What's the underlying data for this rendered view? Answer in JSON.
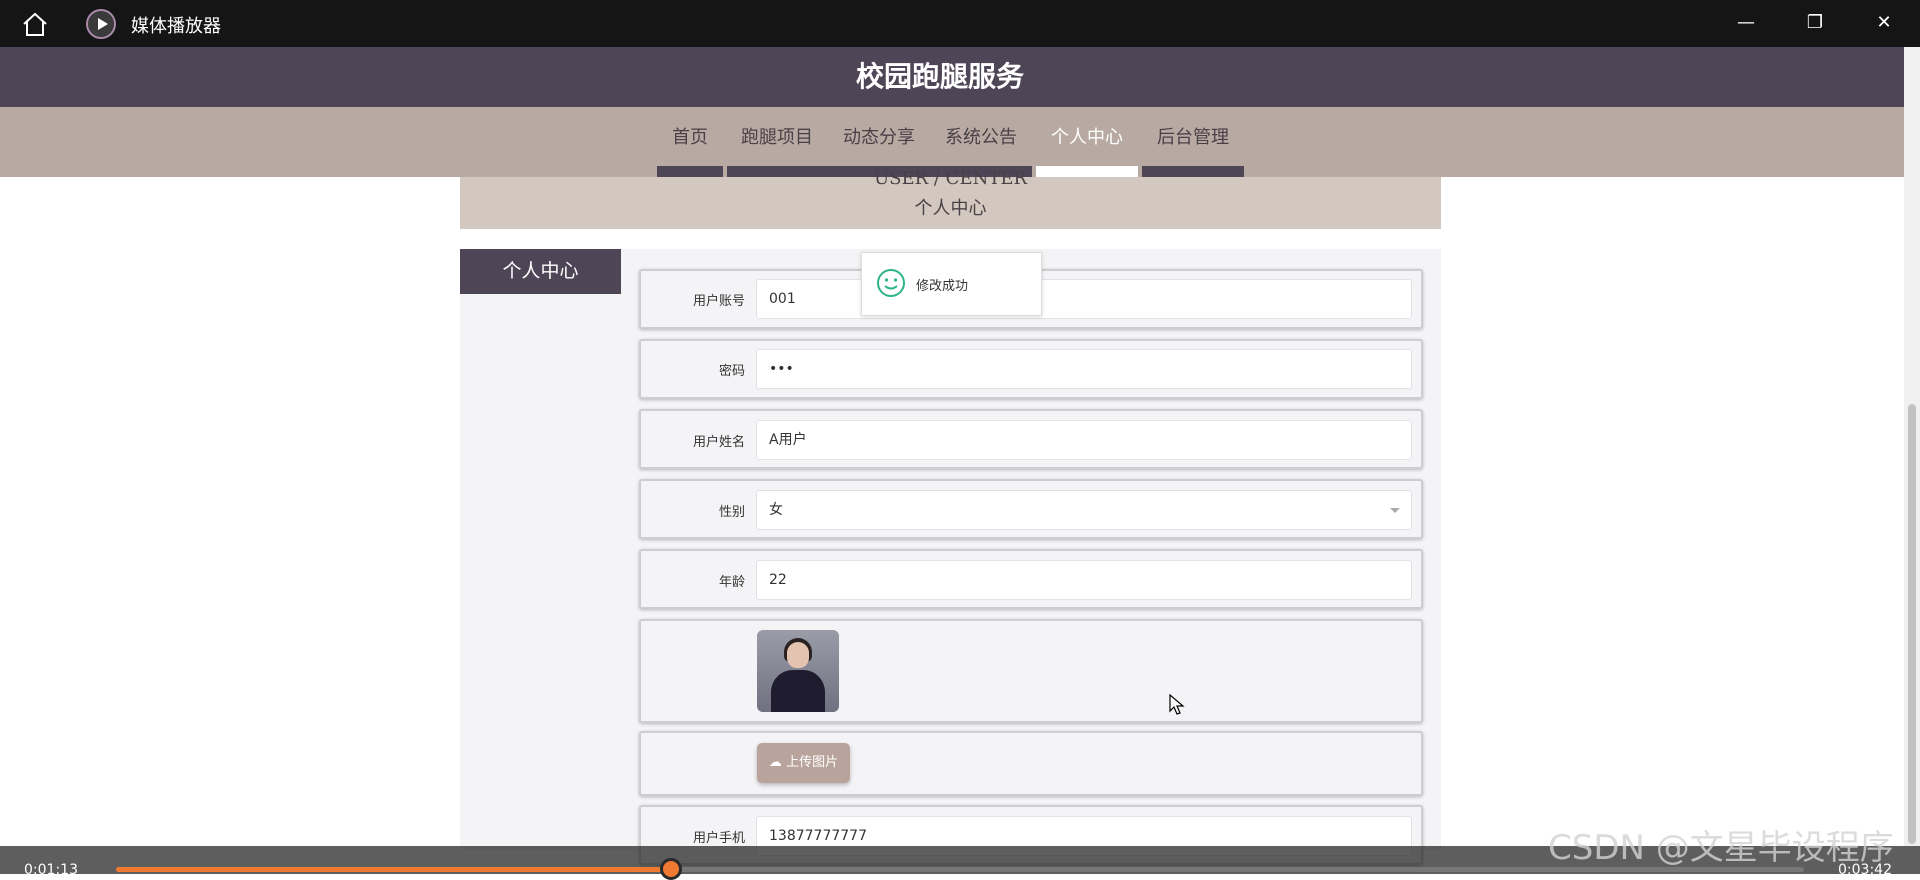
{
  "window": {
    "app_title": "媒体播放器",
    "minimize": "—",
    "restore": "❐",
    "close": "✕"
  },
  "site": {
    "title": "校园跑腿服务",
    "nav": [
      "首页",
      "跑腿项目",
      "动态分享",
      "系统公告",
      "个人中心",
      "后台管理"
    ],
    "active_nav": "个人中心"
  },
  "banner": {
    "en": "USER / CENTER",
    "cn": "个人中心"
  },
  "sidebar": {
    "title": "个人中心"
  },
  "toast": {
    "text": "修改成功",
    "icon": "smile-icon"
  },
  "form": {
    "account_label": "用户账号",
    "account_value": "001",
    "password_label": "密码",
    "password_value": "•••",
    "name_label": "用户姓名",
    "name_value": "A用户",
    "gender_label": "性别",
    "gender_value": "女",
    "age_label": "年龄",
    "age_value": "22",
    "upload_label": "上传图片",
    "phone_label": "用户手机",
    "phone_value": "13877777777"
  },
  "player": {
    "current_time": "0:01:13",
    "total_time": "0:03:42",
    "progress": 0.3287
  },
  "watermark": "CSDN @文星毕设程序",
  "colors": {
    "header": "#4e4656",
    "nav": "#b8aaa2",
    "banner": "#d2c8bf",
    "accent_orange": "#f07a32",
    "toast_icon": "#2fb483"
  }
}
